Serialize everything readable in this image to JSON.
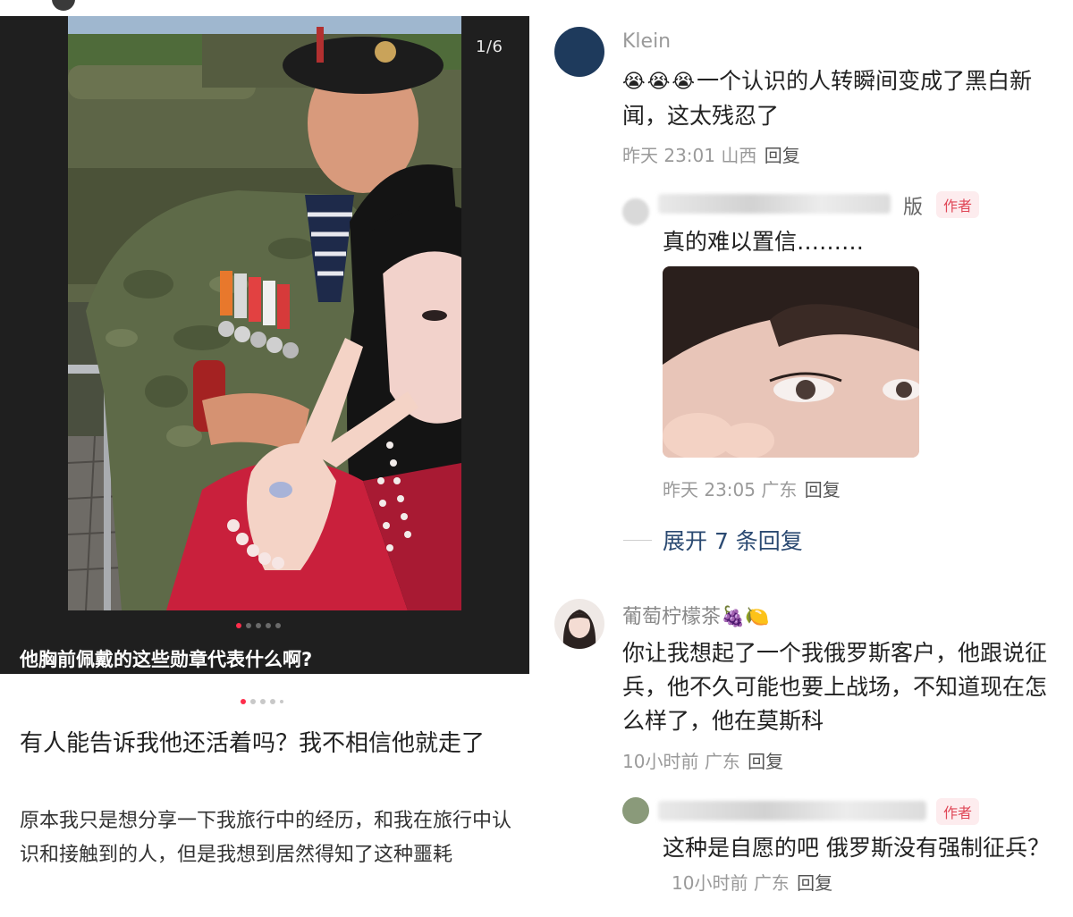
{
  "post": {
    "image_counter": "1/6",
    "image_caption": "他胸前佩戴的这些勋章代表什么啊?",
    "title": "有人能告诉我他还活着吗？我不相信他就走了",
    "body": "原本我只是想分享一下我旅行中的经历，和我在旅行中认识和接触到的人，但是我想到居然得知了这种噩耗"
  },
  "comments": {
    "c1": {
      "name": "Klein",
      "emoji": "😭😭😭",
      "text": "一个认识的人转瞬间变成了黑白新闻，这太残忍了",
      "time": "昨天 23:01",
      "location": "山西",
      "reply_label": "回复"
    },
    "r1": {
      "name_suffix": "版",
      "author_tag": "作者",
      "text": "真的难以置信………",
      "time": "昨天 23:05",
      "location": "广东",
      "reply_label": "回复"
    },
    "expand_label": "展开 7 条回复",
    "c2": {
      "name": "葡萄柠檬茶",
      "name_emoji": "🍇🍋",
      "text": "你让我想起了一个我俄罗斯客户，他跟说征兵，他不久可能也要上战场，不知道现在怎么样了，他在莫斯科",
      "time": "10小时前",
      "location": "广东",
      "reply_label": "回复"
    },
    "r2": {
      "author_tag": "作者",
      "text": "这种是自愿的吧 俄罗斯没有强制征兵？",
      "time": "10小时前",
      "location": "广东",
      "reply_label": "回复"
    }
  },
  "colors": {
    "accent": "#ff2d4b",
    "author_tag": "#e04757",
    "link": "#2b4a72",
    "meta": "#9a9a9a"
  }
}
